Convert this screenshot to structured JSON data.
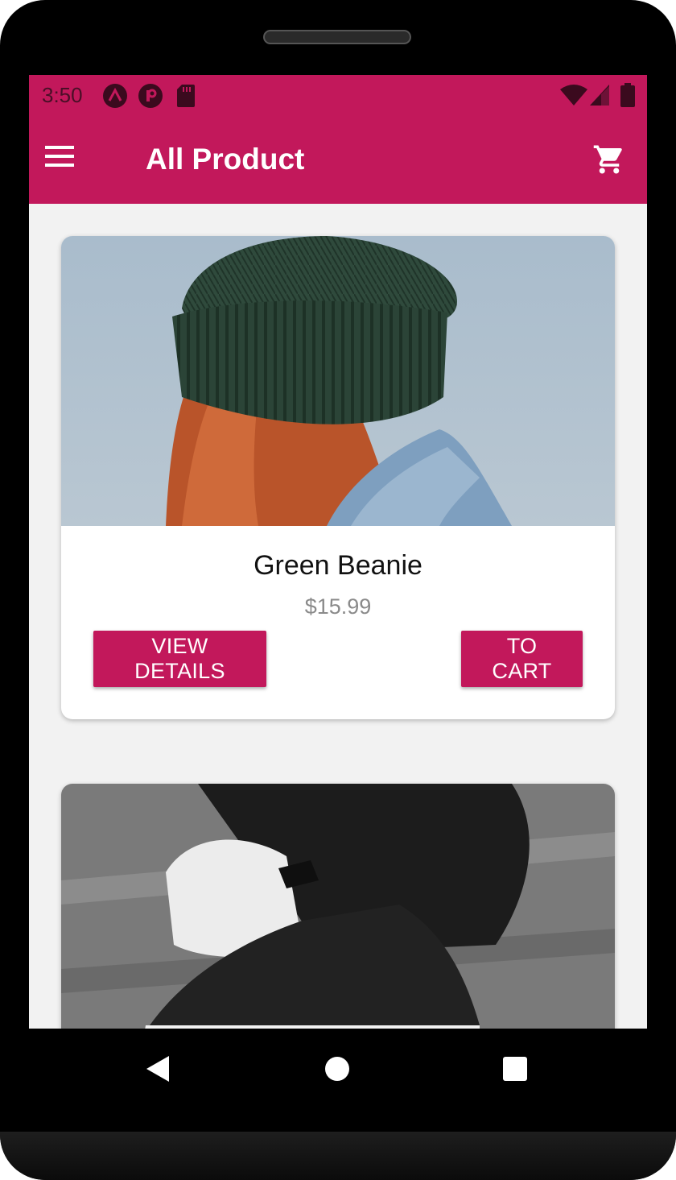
{
  "status_bar": {
    "time": "3:50",
    "icons": [
      "notification-a-icon",
      "notification-p-icon",
      "sd-card-icon",
      "wifi-icon",
      "signal-icon",
      "battery-icon"
    ]
  },
  "app_bar": {
    "title": "All Product",
    "menu_icon": "menu-icon",
    "cart_icon": "shopping-cart-icon"
  },
  "products": [
    {
      "name": "Green Beanie",
      "price": "$15.99",
      "view_label": "VIEW DETAILS",
      "cart_label": "TO CART"
    }
  ],
  "nav": {
    "icons": [
      "back-icon",
      "home-icon",
      "recents-icon"
    ]
  },
  "colors": {
    "primary": "#c2185b",
    "background": "#f2f2f2",
    "price_text": "#8a8a8a"
  }
}
